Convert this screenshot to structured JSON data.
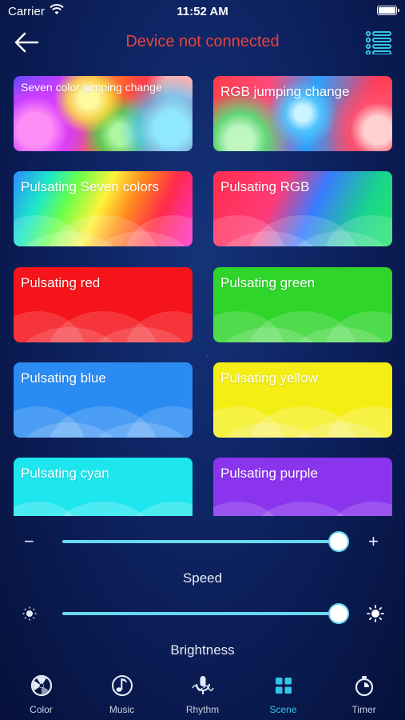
{
  "status_bar": {
    "carrier": "Carrier",
    "time": "11:52 AM"
  },
  "header": {
    "title": "Device not connected",
    "back_icon": "arrow-left-icon",
    "menu_icon": "list-menu-icon"
  },
  "colors": {
    "title": "#e8443d",
    "accent": "#34c6e8",
    "slider": "#6ad8ee"
  },
  "scenes": [
    {
      "label": "Seven color jumping change"
    },
    {
      "label": "RGB jumping change"
    },
    {
      "label": "Pulsating Seven colors"
    },
    {
      "label": "Pulsating RGB"
    },
    {
      "label": "Pulsating red"
    },
    {
      "label": "Pulsating green"
    },
    {
      "label": "Pulsating blue"
    },
    {
      "label": "Pulsating yellow"
    },
    {
      "label": "Pulsating cyan"
    },
    {
      "label": "Pulsating purple"
    }
  ],
  "speed": {
    "label": "Speed",
    "minus": "−",
    "plus": "+",
    "value": 1.0
  },
  "brightness": {
    "label": "Brightness",
    "value": 1.0
  },
  "tabs": [
    {
      "label": "Color",
      "icon": "color-wheel-icon"
    },
    {
      "label": "Music",
      "icon": "music-note-icon"
    },
    {
      "label": "Rhythm",
      "icon": "microphone-icon"
    },
    {
      "label": "Scene",
      "icon": "grid-icon",
      "active": true
    },
    {
      "label": "Timer",
      "icon": "stopwatch-icon"
    }
  ]
}
